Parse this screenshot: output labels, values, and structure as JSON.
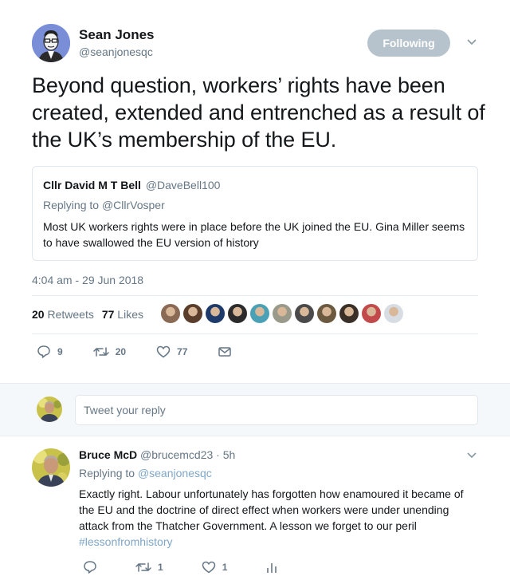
{
  "tweet": {
    "author_name": "Sean Jones",
    "author_handle": "@seanjonesqc",
    "follow_label": "Following",
    "text": "Beyond question, workers’ rights have been created, extended and entrenched as a result of the UK’s membership of the EU.",
    "timestamp": "4:04 am - 29 Jun 2018",
    "retweet_count": "20",
    "retweet_label": "Retweets",
    "like_count": "77",
    "like_label": "Likes",
    "actions": {
      "reply_count": "9",
      "retweet_count": "20",
      "like_count": "77"
    }
  },
  "quoted": {
    "name": "Cllr David M T Bell",
    "handle": "@DaveBell100",
    "replying_prefix": "Replying to",
    "replying_to": "@CllrVosper",
    "text": "Most UK workers rights were in place before the UK joined the EU. Gina Miller seems to have swallowed the EU version of history"
  },
  "liker_colors": [
    "#8a6a55",
    "#5a3d2a",
    "#1d3a6b",
    "#2b2b2b",
    "#4aa0b5",
    "#9a9a8a",
    "#4a4a4a",
    "#6b5a40",
    "#3a3028",
    "#c24a4a",
    "#d7dde3"
  ],
  "reply_box": {
    "placeholder": "Tweet your reply"
  },
  "reply": {
    "name": "Bruce McD",
    "handle": "@brucemcd23",
    "time": "5h",
    "replying_prefix": "Replying to",
    "replying_to": "@seanjonesqc",
    "text": "Exactly right. Labour unfortunately has forgotten how enamoured it became of the EU and the doctrine of direct effect when workers were under unending attack from the Thatcher Government. A lesson we forget to our peril",
    "hashtag": "#lessonfromhistory",
    "retweet_count": "1",
    "like_count": "1"
  },
  "icons": {
    "reply": "reply-icon",
    "retweet": "retweet-icon",
    "like": "heart-icon",
    "dm": "envelope-icon",
    "analytics": "analytics-icon",
    "caret": "chevron-down-icon"
  },
  "colors": {
    "follow_button": "#b6c3cc",
    "secondary_text": "#657786",
    "link": "#7fa6c7",
    "reply_bar_bg": "#f5f8fa"
  }
}
